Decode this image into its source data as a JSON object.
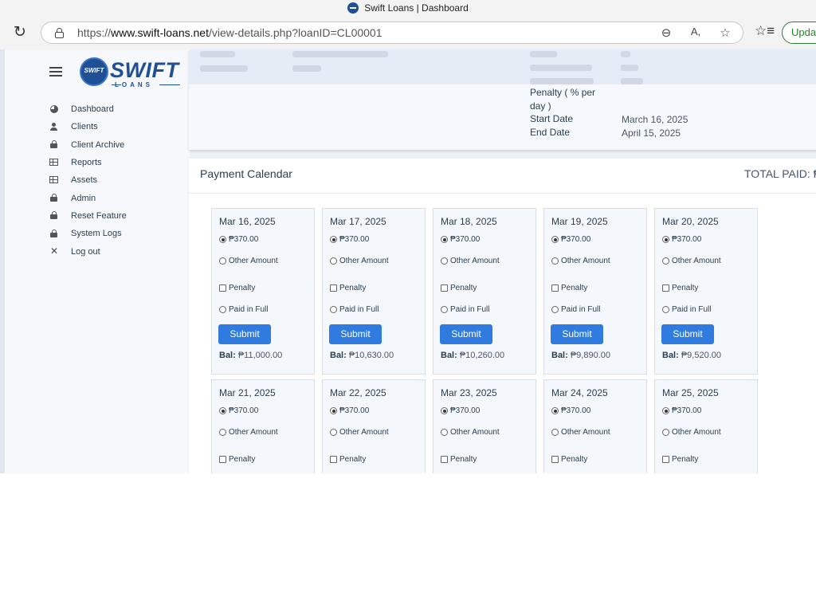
{
  "browser": {
    "window_title": "Swift Loans | Dashboard",
    "url_prefix": "https://",
    "url_host": "www.swift-loans.net",
    "url_path": "/view-details.php?loanID=CL00001",
    "update_label": "Update",
    "icons": [
      "refresh-icon",
      "lock-icon",
      "zoom-out-icon",
      "read-aloud-icon",
      "favorite-star-icon",
      "favorites-bar-icon"
    ]
  },
  "brand": {
    "logo_badge": "SWIFT",
    "logo_word": "SWIFT",
    "logo_sub": "LOANS",
    "color": "#1f4f94"
  },
  "sidebar": {
    "items": [
      {
        "label": "Dashboard",
        "icon": "dashboard-pie-icon"
      },
      {
        "label": "Clients",
        "icon": "user-icon"
      },
      {
        "label": "Client Archive",
        "icon": "lock-icon"
      },
      {
        "label": "Reports",
        "icon": "table-icon"
      },
      {
        "label": "Assets",
        "icon": "table-icon"
      },
      {
        "label": "Admin",
        "icon": "lock-icon"
      },
      {
        "label": "Reset Feature",
        "icon": "lock-icon"
      },
      {
        "label": "System Logs",
        "icon": "lock-icon"
      },
      {
        "label": "Log out",
        "icon": "close-icon"
      }
    ]
  },
  "loan_details": {
    "penalty_label": "Penalty ( % per day )",
    "start_date_label": "Start Date",
    "start_date": "March 16, 2025",
    "end_date_label": "End Date",
    "end_date": "April 15, 2025"
  },
  "calendar": {
    "title": "Payment Calendar",
    "total_paid_label": "TOTAL PAID: ₱",
    "submit_label": "Submit",
    "bal_label": "Bal:",
    "other_amount_label": "Other Amount",
    "penalty_label": "Penalty",
    "paid_in_full_label": "Paid in Full",
    "days": [
      {
        "date": "Mar 16, 2025",
        "amount": "₱370.00",
        "balance": "₱11,000.00"
      },
      {
        "date": "Mar 17, 2025",
        "amount": "₱370.00",
        "balance": "₱10,630.00"
      },
      {
        "date": "Mar 18, 2025",
        "amount": "₱370.00",
        "balance": "₱10,260.00"
      },
      {
        "date": "Mar 19, 2025",
        "amount": "₱370.00",
        "balance": "₱9,890.00"
      },
      {
        "date": "Mar 20, 2025",
        "amount": "₱370.00",
        "balance": "₱9,520.00"
      },
      {
        "date": "Mar 21, 2025",
        "amount": "₱370.00"
      },
      {
        "date": "Mar 22, 2025",
        "amount": "₱370.00"
      },
      {
        "date": "Mar 23, 2025",
        "amount": "₱370.00"
      },
      {
        "date": "Mar 24, 2025",
        "amount": "₱370.00"
      },
      {
        "date": "Mar 25, 2025",
        "amount": "₱370.00"
      }
    ]
  },
  "colors": {
    "accent": "#2f7be0",
    "text": "#2c3e50"
  }
}
